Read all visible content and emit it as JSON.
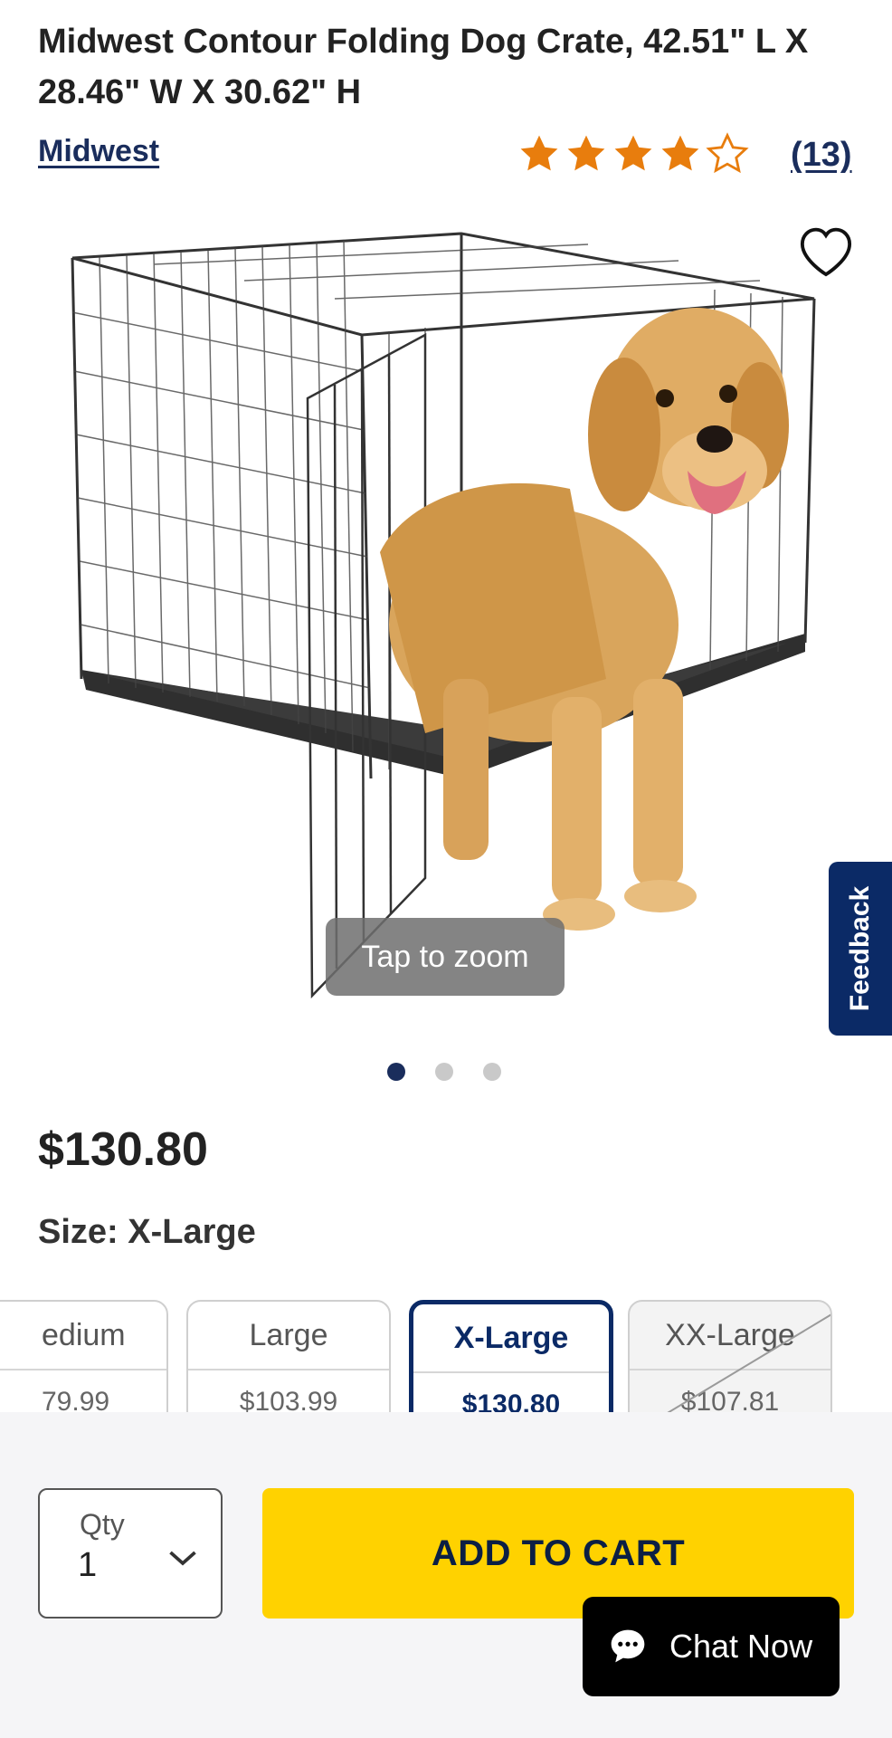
{
  "product": {
    "title": "Midwest Contour Folding Dog Crate, 42.51\" L X 28.46\" W X 30.62\" H",
    "brand": "Midwest",
    "rating": 4,
    "rating_max": 5,
    "review_count": "(13)",
    "image_icon": "dog-crate-with-golden-retriever",
    "zoom_label": "Tap to zoom",
    "image_count": 3,
    "active_image": 1,
    "price": "$130.80"
  },
  "size": {
    "label": "Size: X-Large",
    "options": [
      {
        "name": "edium",
        "price": "79.99",
        "state": "clipped"
      },
      {
        "name": "Large",
        "price": "$103.99",
        "state": "available"
      },
      {
        "name": "X-Large",
        "price": "$130.80",
        "state": "selected"
      },
      {
        "name": "XX-Large",
        "price": "$107.81",
        "state": "unavailable"
      }
    ]
  },
  "feedback": {
    "label": "Feedback"
  },
  "purchase": {
    "qty_label": "Qty",
    "qty_value": "1",
    "add_to_cart": "ADD TO CART",
    "chat_label": "Chat Now"
  },
  "colors": {
    "navy": "#0b2a66",
    "star": "#e87d0d",
    "cart": "#ffd200"
  }
}
